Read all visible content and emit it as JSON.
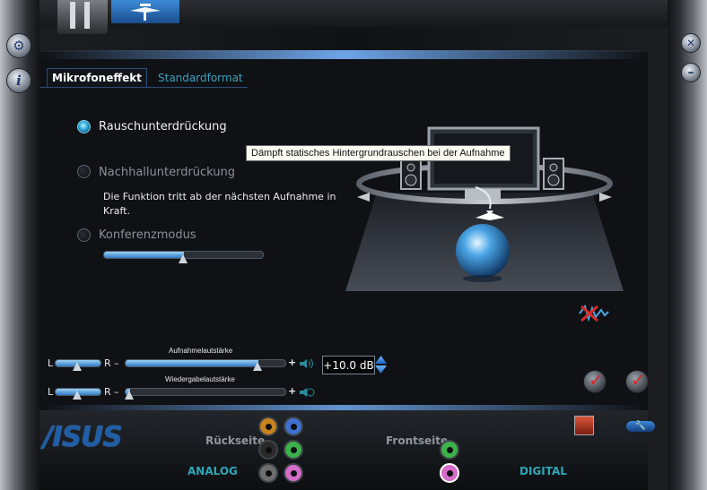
{
  "tabs": {
    "active": "Mikrofoneffekt",
    "inactive": "Standardformat"
  },
  "options": {
    "noise": "Rauschunterdrückung",
    "echo": "Nachhallunterdrückung",
    "note": "Die Funktion tritt ab der nächsten Aufnahme in Kraft.",
    "conference": "Konferenzmodus",
    "noise_selected": true
  },
  "tooltip": "Dämpft statisches Hintergrundrauschen bei der Aufnahme",
  "volume": {
    "record_label": "Aufnahmelautstärke",
    "playback_label": "Wiedergabelautstärke",
    "left": "L",
    "right": "R",
    "minus": "–",
    "plus": "+",
    "db_value": "+10.0 dB",
    "record_level": 0.83,
    "playback_level": 0.03,
    "record_balance": 0.5,
    "playback_balance": 0.5,
    "conference_level": 0.5
  },
  "bottom": {
    "logo": "/ISUS",
    "rear": "Rückseite",
    "front": "Frontseite",
    "analog": "ANALOG",
    "digital": "DIGITAL"
  },
  "jack_colors": {
    "orange": "#c8821e",
    "blue": "#3f6fd0",
    "black": "#2a2a2a",
    "green": "#3bb24a",
    "gray": "#6e6e6e",
    "pink": "#d56cc9"
  }
}
